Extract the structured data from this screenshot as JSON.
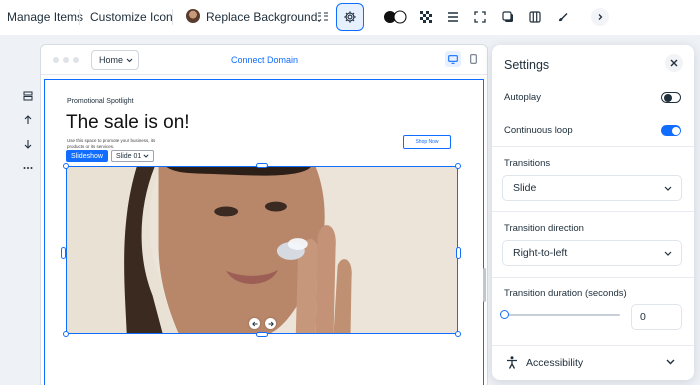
{
  "toolbar": {
    "manage_items": "Manage Items",
    "customize_icon": "Customize Icon",
    "replace_background": "Replace Background"
  },
  "editor": {
    "page_dropdown": "Home",
    "connect_domain": "Connect Domain"
  },
  "canvas": {
    "kicker": "Promotional Spotlight",
    "title": "The sale is on!",
    "body": "Use this space to promote your business, its products or its services.",
    "shop_button": "Shop Now",
    "element_badge": "Slideshow",
    "slide_dropdown": "Slide 01"
  },
  "settings": {
    "title": "Settings",
    "autoplay": {
      "label": "Autoplay",
      "on": false
    },
    "continuous_loop": {
      "label": "Continuous loop",
      "on": true
    },
    "transitions": {
      "label": "Transitions",
      "value": "Slide"
    },
    "transition_direction": {
      "label": "Transition direction",
      "value": "Right-to-left"
    },
    "transition_duration": {
      "label": "Transition duration (seconds)",
      "value": "0",
      "fraction": 0
    },
    "accessibility": "Accessibility"
  },
  "colors": {
    "accent": "#116dff",
    "text": "#20303c",
    "background": "#eef1f6"
  },
  "icons": [
    "avatar-icon",
    "checklist-icon",
    "gear-icon",
    "contrast-icon",
    "checker-icon",
    "lines-icon",
    "crop-icon",
    "shadow-icon",
    "columns-icon",
    "brush-icon",
    "chevron-right-icon",
    "layers-icon",
    "arrow-up-icon",
    "arrow-down-icon",
    "more-icon",
    "close-icon",
    "chevron-down-icon",
    "desktop-icon",
    "mobile-icon",
    "accessibility-icon"
  ]
}
